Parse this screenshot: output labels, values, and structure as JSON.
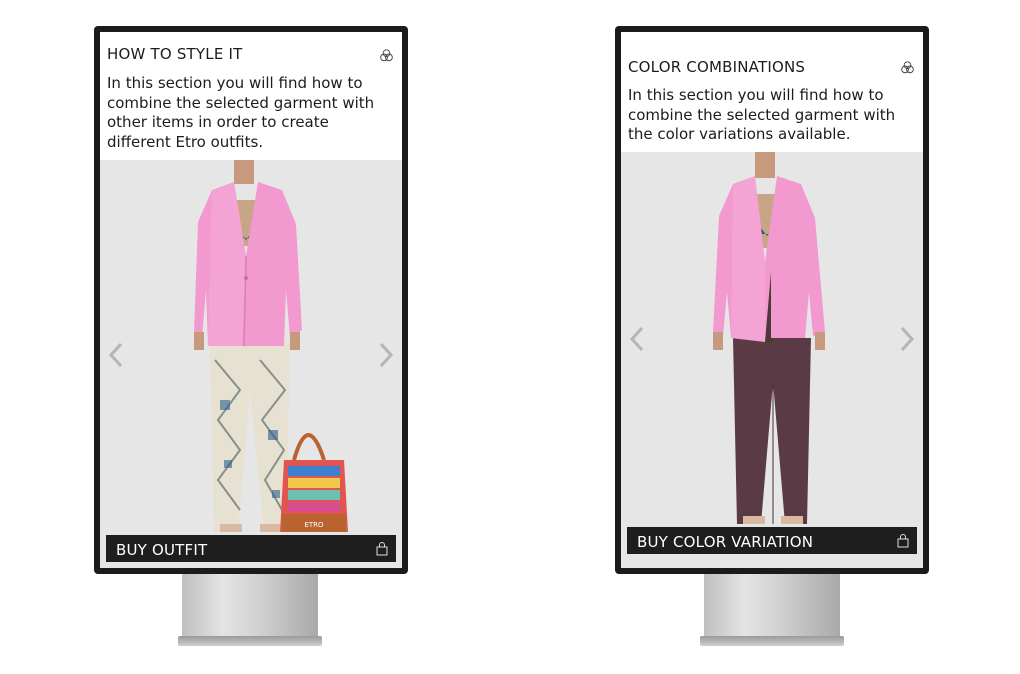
{
  "screens": {
    "left": {
      "title": "HOW TO STYLE IT",
      "description": "In this section you will find how to combine the selected garment with other items in order to create different Etro outfits.",
      "buy_label": "BUY OUTFIT",
      "icons": {
        "header": "color-rings-icon",
        "buy": "shopping-bag-icon",
        "prev": "chevron-left-icon",
        "next": "chevron-right-icon"
      },
      "bag_logo": "ETRO"
    },
    "right": {
      "title": "COLOR COMBINATIONS",
      "description": "In this section you will find how to combine the selected garment with the color variations available.",
      "buy_label": "BUY COLOR VARIATION",
      "icons": {
        "header": "color-rings-icon",
        "buy": "shopping-bag-icon",
        "prev": "chevron-left-icon",
        "next": "chevron-right-icon"
      }
    }
  },
  "colors": {
    "blazer": "#f29ad0",
    "bezel": "#1b1b1b",
    "buy_bar": "#1e1e1e",
    "stage": "#e6e6e6",
    "left_trousers": "#e7e1d2",
    "right_trousers": "#5a3a45",
    "bag_leather": "#b9642e"
  }
}
